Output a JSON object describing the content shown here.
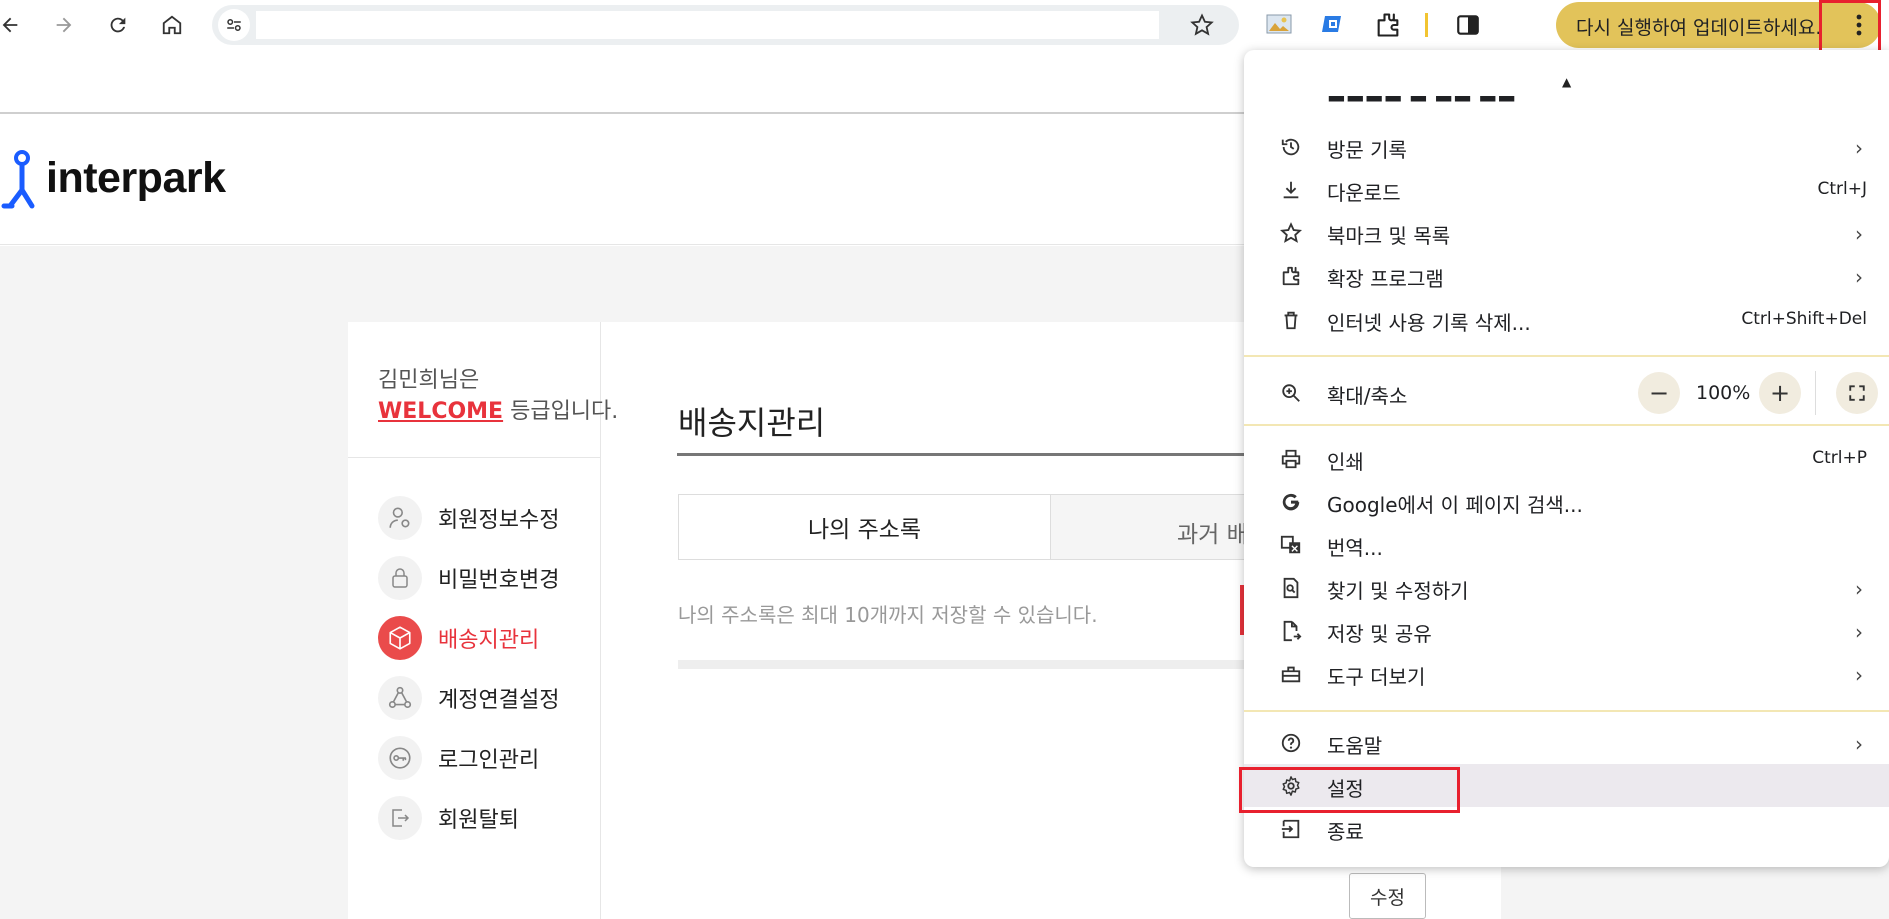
{
  "toolbar": {
    "update_label": "다시 실행하여 업데이트하세요.",
    "icons": [
      "back-icon",
      "forward-icon",
      "reload-icon",
      "home-icon",
      "tune-icon",
      "bookmark-star-icon",
      "extension-image-icon",
      "extension-translate-icon",
      "extensions-puzzle-icon",
      "side-panel-icon",
      "more-vert-icon"
    ]
  },
  "site": {
    "logo_text": "interpark",
    "greeting_line1": "김민희님은",
    "grade": "WELCOME",
    "grade_suffix": " 등급입니다.",
    "sidebar_items": [
      {
        "label": "회원정보수정",
        "icon": "user-settings-icon",
        "active": false
      },
      {
        "label": "비밀번호변경",
        "icon": "lock-icon",
        "active": false
      },
      {
        "label": "배송지관리",
        "icon": "box-icon",
        "active": true
      },
      {
        "label": "계정연결설정",
        "icon": "link-nodes-icon",
        "active": false
      },
      {
        "label": "로그인관리",
        "icon": "key-icon",
        "active": false
      },
      {
        "label": "회원탈퇴",
        "icon": "exit-icon",
        "active": false
      }
    ],
    "page_title": "배송지관리",
    "tab1": "나의 주소록",
    "tab2": "과거 배",
    "notice": "나의 주소록은 최대 10개까지 저장할 수 있습니다.",
    "edit_button": "수정"
  },
  "chrome_menu": {
    "items_group1": [
      {
        "label": "방문 기록",
        "shortcut": "",
        "submenu": true,
        "icon": "history-icon"
      },
      {
        "label": "다운로드",
        "shortcut": "Ctrl+J",
        "submenu": false,
        "icon": "download-icon"
      },
      {
        "label": "북마크 및 목록",
        "shortcut": "",
        "submenu": true,
        "icon": "star-icon"
      },
      {
        "label": "확장 프로그램",
        "shortcut": "",
        "submenu": true,
        "icon": "puzzle-icon"
      },
      {
        "label": "인터넷 사용 기록 삭제...",
        "shortcut": "Ctrl+Shift+Del",
        "submenu": false,
        "icon": "trash-icon"
      }
    ],
    "zoom": {
      "label": "확대/축소",
      "value": "100%",
      "minus": "−",
      "plus": "+"
    },
    "items_group2": [
      {
        "label": "인쇄",
        "shortcut": "Ctrl+P",
        "submenu": false,
        "icon": "print-icon"
      },
      {
        "label": "Google에서 이 페이지 검색...",
        "shortcut": "",
        "submenu": false,
        "icon": "google-icon"
      },
      {
        "label": "번역...",
        "shortcut": "",
        "submenu": false,
        "icon": "translate-icon"
      },
      {
        "label": "찾기 및 수정하기",
        "shortcut": "",
        "submenu": true,
        "icon": "find-icon"
      },
      {
        "label": "저장 및 공유",
        "shortcut": "",
        "submenu": true,
        "icon": "save-share-icon"
      },
      {
        "label": "도구 더보기",
        "shortcut": "",
        "submenu": true,
        "icon": "toolbox-icon"
      }
    ],
    "items_group3": [
      {
        "label": "도움말",
        "shortcut": "",
        "submenu": true,
        "icon": "help-icon"
      },
      {
        "label": "설정",
        "shortcut": "",
        "submenu": false,
        "icon": "settings-gear-icon"
      },
      {
        "label": "종료",
        "shortcut": "",
        "submenu": false,
        "icon": "exit-icon"
      }
    ],
    "arrow_glyph": "›"
  },
  "colors": {
    "accent_red": "#e8202e",
    "update_pill": "#e2c35a",
    "menu_highlight": "#ece9ee"
  }
}
